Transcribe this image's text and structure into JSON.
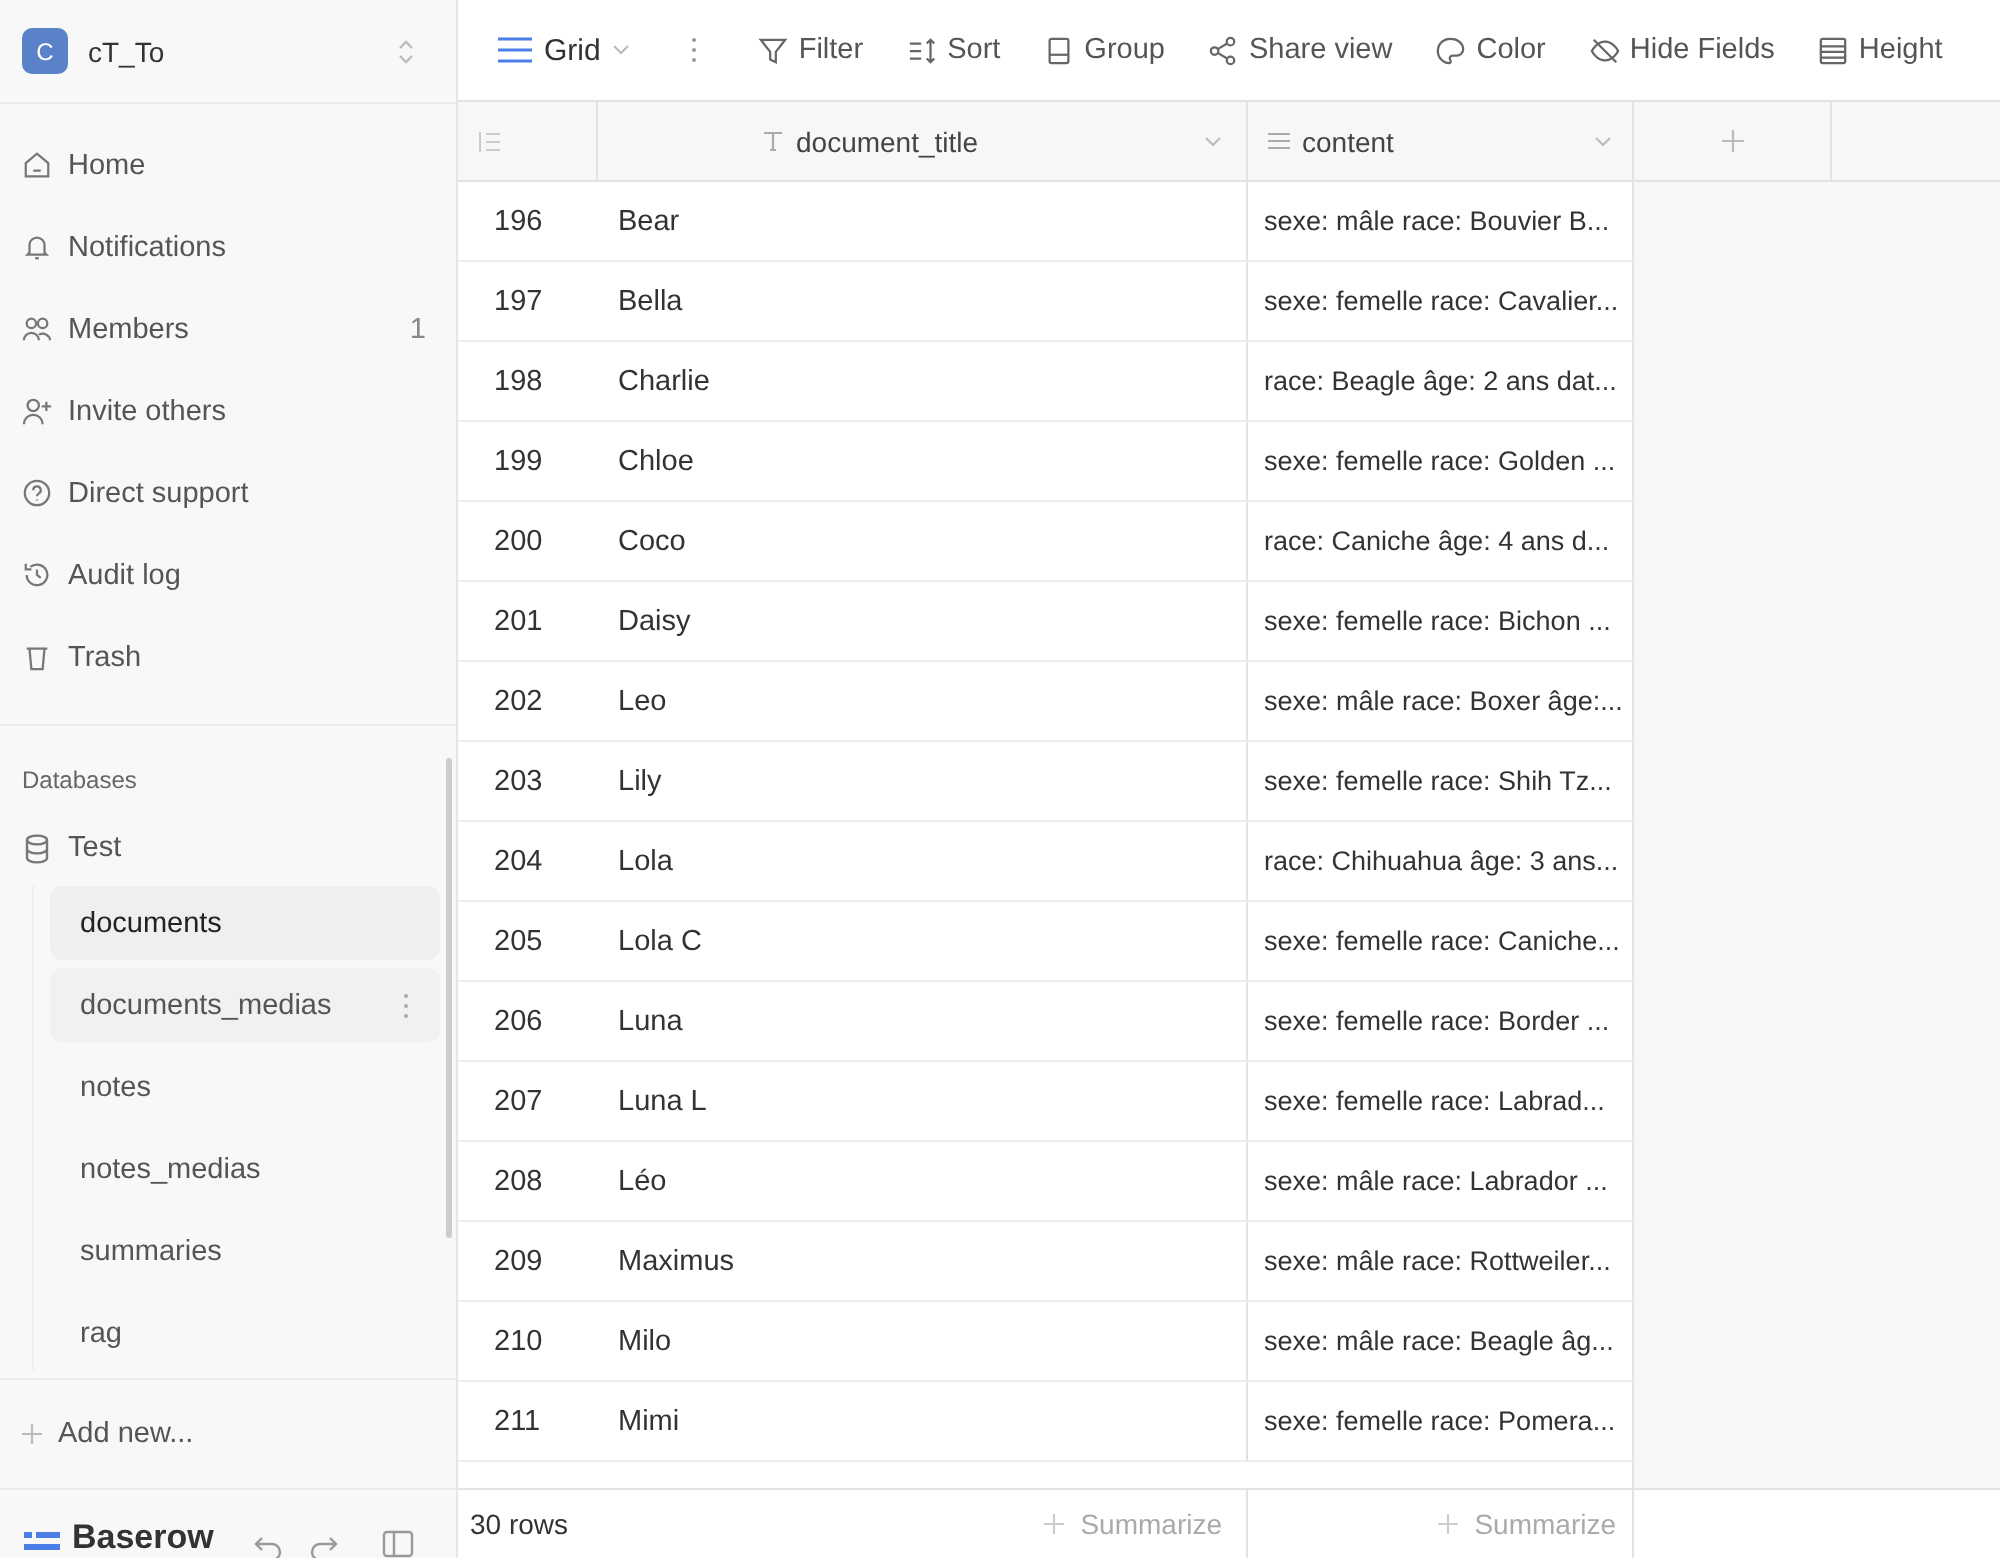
{
  "workspace": {
    "initial": "C",
    "name": "cT_To"
  },
  "nav": [
    {
      "label": "Home"
    },
    {
      "label": "Notifications"
    },
    {
      "label": "Members",
      "count": "1"
    },
    {
      "label": "Invite others"
    },
    {
      "label": "Direct support"
    },
    {
      "label": "Audit log"
    },
    {
      "label": "Trash"
    }
  ],
  "databases": {
    "heading": "Databases",
    "database": "Test",
    "tables": [
      {
        "label": "documents",
        "selected": true,
        "hovered": false
      },
      {
        "label": "documents_medias",
        "selected": false,
        "hovered": true
      },
      {
        "label": "notes",
        "selected": false,
        "hovered": false
      },
      {
        "label": "notes_medias",
        "selected": false,
        "hovered": false
      },
      {
        "label": "summaries",
        "selected": false,
        "hovered": false
      },
      {
        "label": "rag",
        "selected": false,
        "hovered": false
      }
    ]
  },
  "add_new": "Add new...",
  "brand": "Baserow",
  "toolbar": {
    "view": "Grid",
    "actions": [
      {
        "label": "Filter"
      },
      {
        "label": "Sort"
      },
      {
        "label": "Group"
      },
      {
        "label": "Share view"
      },
      {
        "label": "Color"
      },
      {
        "label": "Hide Fields"
      },
      {
        "label": "Height"
      }
    ]
  },
  "table": {
    "columns": [
      {
        "kind": "text",
        "name": "document_title"
      },
      {
        "kind": "longtext",
        "name": "content"
      }
    ],
    "rows": [
      {
        "id": "196",
        "title": "Bear",
        "content": "sexe: mâle race: Bouvier B..."
      },
      {
        "id": "197",
        "title": "Bella",
        "content": "sexe: femelle race: Cavalier..."
      },
      {
        "id": "198",
        "title": "Charlie",
        "content": "race: Beagle âge: 2 ans dat..."
      },
      {
        "id": "199",
        "title": "Chloe",
        "content": "sexe: femelle race: Golden ..."
      },
      {
        "id": "200",
        "title": "Coco",
        "content": "race: Caniche âge: 4 ans d..."
      },
      {
        "id": "201",
        "title": "Daisy",
        "content": "sexe: femelle race: Bichon ..."
      },
      {
        "id": "202",
        "title": "Leo",
        "content": "sexe: mâle race: Boxer âge:..."
      },
      {
        "id": "203",
        "title": "Lily",
        "content": "sexe: femelle race: Shih Tz..."
      },
      {
        "id": "204",
        "title": "Lola",
        "content": "race: Chihuahua âge: 3 ans..."
      },
      {
        "id": "205",
        "title": "Lola C",
        "content": "sexe: femelle race: Caniche..."
      },
      {
        "id": "206",
        "title": "Luna",
        "content": "sexe: femelle race: Border ..."
      },
      {
        "id": "207",
        "title": "Luna L",
        "content": "sexe: femelle race: Labrad..."
      },
      {
        "id": "208",
        "title": "Léo",
        "content": "sexe: mâle race: Labrador ..."
      },
      {
        "id": "209",
        "title": "Maximus",
        "content": "sexe: mâle race: Rottweiler..."
      },
      {
        "id": "210",
        "title": "Milo",
        "content": "sexe: mâle race: Beagle âg..."
      },
      {
        "id": "211",
        "title": "Mimi",
        "content": "sexe: femelle race: Pomera..."
      }
    ]
  },
  "footer": {
    "count": "30 rows",
    "summarize": [
      "Summarize",
      "Summarize"
    ]
  }
}
